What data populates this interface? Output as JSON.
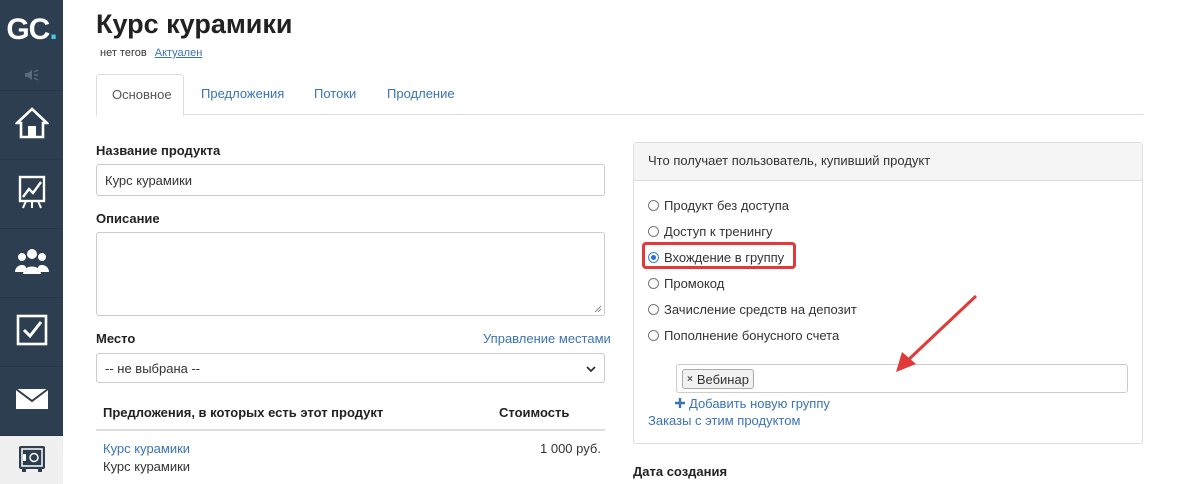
{
  "sidebar": {
    "logo_text": "GC",
    "logo_dot": ".",
    "accent": "#43c6e7",
    "items": [
      {
        "icon": "home-icon"
      },
      {
        "icon": "chart-icon"
      },
      {
        "icon": "users-icon"
      },
      {
        "icon": "checkbox-icon"
      },
      {
        "icon": "mail-icon"
      },
      {
        "icon": "safe-icon"
      }
    ]
  },
  "header": {
    "title": "Курс курамики",
    "tags_text": "нет тегов",
    "status_link": "Актуален"
  },
  "tabs": [
    {
      "label": "Основное",
      "active": true
    },
    {
      "label": "Предложения"
    },
    {
      "label": "Потоки"
    },
    {
      "label": "Продление"
    }
  ],
  "form": {
    "name_label": "Название продукта",
    "name_value": "Курс курамики",
    "description_label": "Описание",
    "place_label": "Место",
    "manage_places_link": "Управление местами",
    "place_select": "-- не выбрана --"
  },
  "offers_table": {
    "headers": [
      "Предложения, в которых есть этот продукт",
      "Стоимость"
    ],
    "rows": [
      {
        "link": "Курс курамики",
        "sub": "Курс курамики",
        "price": "1 000 руб."
      }
    ]
  },
  "access_panel": {
    "title": "Что получает пользователь, купивший продукт",
    "options": [
      {
        "label": "Продукт без доступа",
        "checked": false
      },
      {
        "label": "Доступ к тренингу",
        "checked": false
      },
      {
        "label": "Вхождение в группу",
        "checked": true
      },
      {
        "label": "Промокод",
        "checked": false
      },
      {
        "label": "Зачисление средств на депозит",
        "checked": false
      },
      {
        "label": "Пополнение бонусного счета",
        "checked": false
      }
    ],
    "group_chip": "Вебинар",
    "chip_remove": "×",
    "add_group_link": "Добавить новую группу",
    "orders_link": "Заказы с этим продуктом",
    "highlight_color": "#e03a3a"
  },
  "created_label": "Дата создания"
}
